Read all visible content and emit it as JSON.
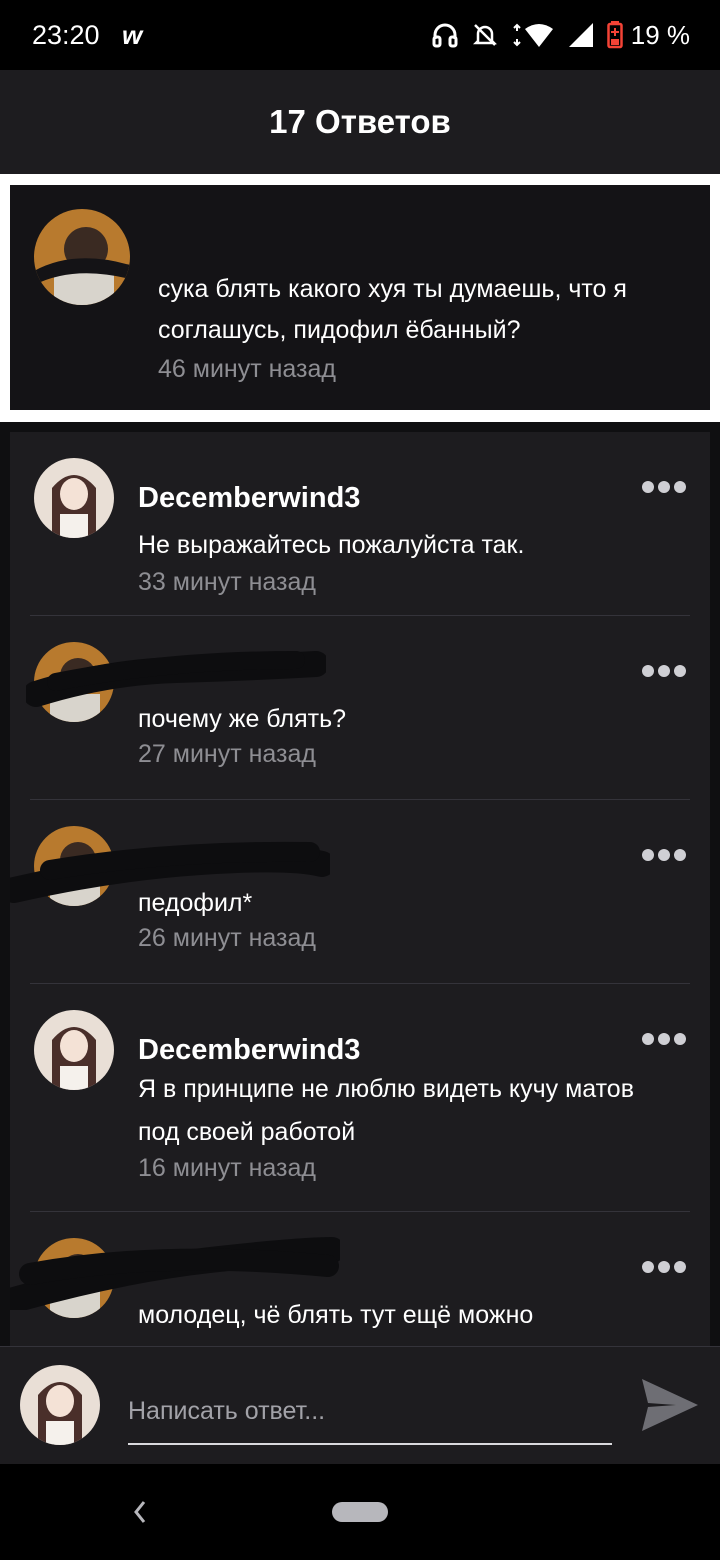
{
  "status_bar": {
    "time": "23:20",
    "app_badge": "w",
    "battery": "19 %",
    "icons": [
      "headphones-icon",
      "bell-off-icon",
      "wifi-icon",
      "cell-signal-icon",
      "battery-icon"
    ],
    "battery_color": "#f44336"
  },
  "header": {
    "title": "17 Ответов"
  },
  "parent_comment": {
    "text": "сука блять какого хуя ты думаешь, что я соглашусь, пидофил ёбанный?",
    "time": "46 минут назад"
  },
  "replies": [
    {
      "author": "Decemberwind3",
      "text": "Не выражайтесь пожалуйста так.",
      "time": "33 минут назад",
      "redacted": false
    },
    {
      "author": "",
      "text": "почему же блять?",
      "time": "27 минут назад",
      "redacted": true
    },
    {
      "author": "",
      "text": "педофил*",
      "time": "26 минут назад",
      "redacted": true
    },
    {
      "author": "Decemberwind3",
      "text": "Я в принципе не люблю видеть кучу матов под своей работой",
      "time": "16 минут назад",
      "redacted": false
    },
    {
      "author": "",
      "text": "молодец, чё блять тут ещё можно",
      "time": "",
      "redacted": true
    }
  ],
  "compose": {
    "placeholder": "Написать ответ..."
  },
  "colors": {
    "background": "#000000",
    "panel": "#1d1c1f",
    "parent_card": "#141316",
    "muted_text": "#8e8e93",
    "divider": "#34333a"
  }
}
